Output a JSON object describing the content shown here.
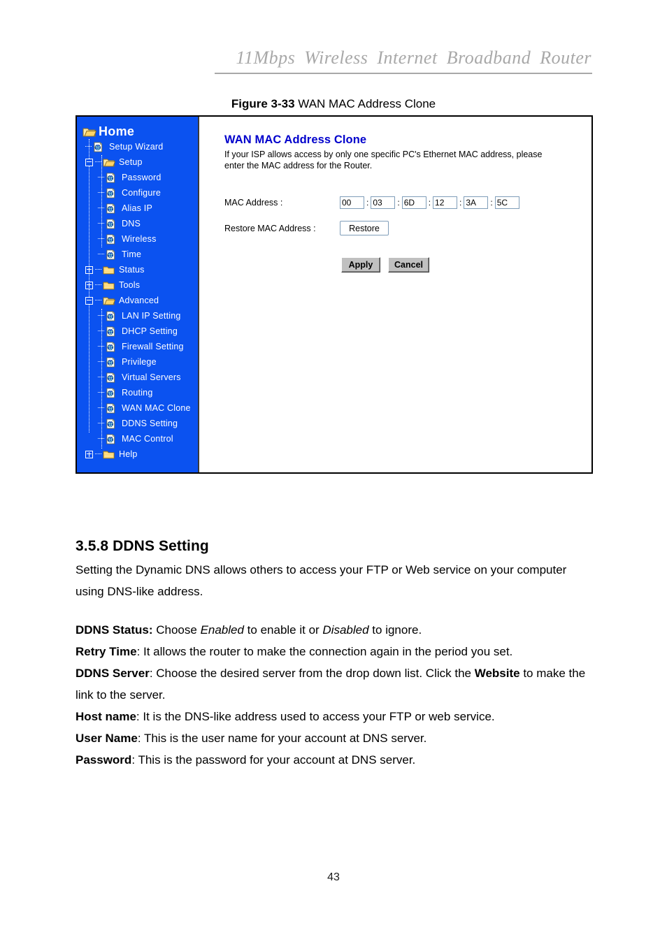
{
  "running_head": "11Mbps  Wireless  Internet  Broadband  Router",
  "figure": {
    "number": "Figure 3-33",
    "caption": " WAN MAC Address Clone"
  },
  "screenshot": {
    "sidebar": {
      "root_label": "Home",
      "items": [
        {
          "label": "Setup Wizard",
          "icon": "page-globe-icon",
          "level": 1,
          "expander": "none",
          "stub": true
        },
        {
          "label": "Setup",
          "icon": "folder-open-icon",
          "level": 1,
          "expander": "minus",
          "stub": false
        },
        {
          "label": "Password",
          "icon": "page-globe-icon",
          "level": 2,
          "expander": "none",
          "stub": true
        },
        {
          "label": "Configure",
          "icon": "page-globe-icon",
          "level": 2,
          "expander": "none",
          "stub": true
        },
        {
          "label": "Alias IP",
          "icon": "page-globe-icon",
          "level": 2,
          "expander": "none",
          "stub": true
        },
        {
          "label": "DNS",
          "icon": "page-globe-icon",
          "level": 2,
          "expander": "none",
          "stub": true
        },
        {
          "label": "Wireless",
          "icon": "page-globe-icon",
          "level": 2,
          "expander": "none",
          "stub": true
        },
        {
          "label": "Time",
          "icon": "page-globe-icon",
          "level": 2,
          "expander": "none",
          "stub": true
        },
        {
          "label": "Status",
          "icon": "folder-closed-icon",
          "level": 1,
          "expander": "plus",
          "stub": false
        },
        {
          "label": "Tools",
          "icon": "folder-closed-icon",
          "level": 1,
          "expander": "plus",
          "stub": false
        },
        {
          "label": "Advanced",
          "icon": "folder-open-icon",
          "level": 1,
          "expander": "minus",
          "stub": false
        },
        {
          "label": "LAN IP Setting",
          "icon": "page-globe-icon",
          "level": 2,
          "expander": "none",
          "stub": true
        },
        {
          "label": "DHCP Setting",
          "icon": "page-globe-icon",
          "level": 2,
          "expander": "none",
          "stub": true
        },
        {
          "label": "Firewall Setting",
          "icon": "page-globe-icon",
          "level": 2,
          "expander": "none",
          "stub": true
        },
        {
          "label": "Privilege",
          "icon": "page-globe-icon",
          "level": 2,
          "expander": "none",
          "stub": true
        },
        {
          "label": "Virtual Servers",
          "icon": "page-globe-icon",
          "level": 2,
          "expander": "none",
          "stub": true
        },
        {
          "label": "Routing",
          "icon": "page-globe-icon",
          "level": 2,
          "expander": "none",
          "stub": true
        },
        {
          "label": "WAN MAC Clone",
          "icon": "page-globe-icon",
          "level": 2,
          "expander": "none",
          "stub": true
        },
        {
          "label": "DDNS Setting",
          "icon": "page-globe-icon",
          "level": 2,
          "expander": "none",
          "stub": true
        },
        {
          "label": "MAC Control",
          "icon": "page-globe-icon",
          "level": 2,
          "expander": "none",
          "stub": true
        },
        {
          "label": "Help",
          "icon": "folder-closed-icon",
          "level": 1,
          "expander": "plus",
          "stub": false
        }
      ]
    },
    "main": {
      "title": "WAN MAC Address Clone",
      "description": "If your ISP allows access by only one specific PC's Ethernet MAC address, please enter the MAC address for the Router.",
      "mac_label": "MAC Address :",
      "mac_octets": [
        "00",
        "03",
        "6D",
        "12",
        "3A",
        "5C"
      ],
      "mac_separator": ":",
      "restore_label": "Restore MAC Address :",
      "restore_button": "Restore",
      "apply_button": "Apply",
      "cancel_button": "Cancel"
    },
    "colors": {
      "sidebar_bg": "#0b52f0",
      "title_blue": "#0000cc",
      "button_gray": "#c0c0c0",
      "input_border": "#7f9db9"
    }
  },
  "section": {
    "heading": "3.5.8 DDNS Setting",
    "intro": "Setting the Dynamic DNS allows others to access your FTP or Web service on your computer using DNS-like address.",
    "definitions": [
      {
        "term": "DDNS Status:",
        "pre": " Choose ",
        "em1": "Enabled",
        "mid": " to enable it or ",
        "em2": "Disabled",
        "post": " to ignore."
      },
      {
        "term": "Retry Time",
        "pre": ": It allows the router to make the connection again in the period you set.",
        "em1": "",
        "mid": "",
        "em2": "",
        "post": ""
      },
      {
        "term": "DDNS Server",
        "pre": ": Choose the desired server from the drop down list. Click the ",
        "strong": "Website",
        "post": " to make the link to the server."
      },
      {
        "term": "Host name",
        "pre": ": It is the DNS-like address used to access your FTP or web service.",
        "post": ""
      },
      {
        "term": "User Name",
        "pre": ": This is the user name for your account at DNS server.",
        "post": ""
      },
      {
        "term": "Password",
        "pre": ": This is the password for your account at DNS server.",
        "post": ""
      }
    ]
  },
  "footer": {
    "page_number": "43"
  }
}
